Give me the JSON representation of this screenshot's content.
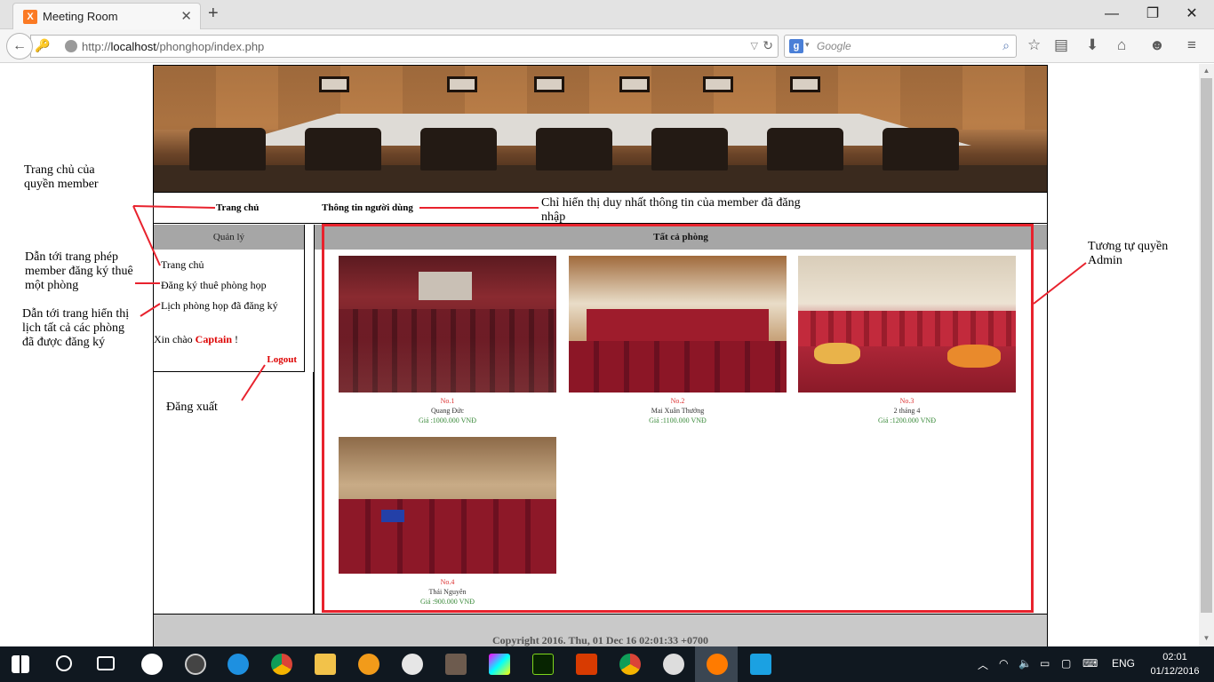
{
  "browser": {
    "tab_title": "Meeting Room",
    "tab_icon": "X",
    "new_tab": "+",
    "url_prefix": "http://",
    "url_host": "localhost",
    "url_path": "/phonghop/index.php",
    "search_placeholder": "Google",
    "search_engine_icon": "g"
  },
  "nav": {
    "home": "Trang chủ",
    "user_info": "Thông tin người dùng"
  },
  "sidebar": {
    "header": "Quản lý",
    "items": [
      "Trang chủ",
      "Đăng ký thuê phòng họp",
      "Lịch phòng họp đã đăng ký"
    ],
    "greeting_prefix": "Xin chào ",
    "username": "Captain",
    "greeting_suffix": " !",
    "logout": "Logout"
  },
  "main": {
    "header": "Tất cả phòng",
    "rooms": [
      {
        "no": "No.1",
        "name": "Quang Đức",
        "price": "Giá :1000.000 VNĐ"
      },
      {
        "no": "No.2",
        "name": "Mai Xuân Thưởng",
        "price": "Giá :1100.000 VNĐ"
      },
      {
        "no": "No.3",
        "name": "2 tháng 4",
        "price": "Giá :1200.000 VNĐ"
      },
      {
        "no": "No.4",
        "name": "Thái Nguyên",
        "price": "Giá :900.000 VNĐ"
      }
    ]
  },
  "footer": "Copyright 2016. Thu, 01 Dec 16 02:01:33 +0700",
  "annotations": {
    "member_home": "Trang chủ của quyền member",
    "register_room": "Dẫn tới trang phép member đăng ký thuê một phòng",
    "schedule": "Dẫn tới trang hiển thị lịch tất cả các phòng đã được đăng ký",
    "logout_note": "Đăng xuất",
    "user_info_note": "Chỉ hiển thị duy nhất thông tin của member đã đăng nhập",
    "admin_note": "Tương tự quyền Admin"
  },
  "taskbar": {
    "language": "ENG",
    "time": "02:01",
    "date": "01/12/2016"
  },
  "colors": {
    "accent_red": "#e8222d",
    "header_gray": "#a6a6a6",
    "price_green": "#3a8a3a"
  }
}
